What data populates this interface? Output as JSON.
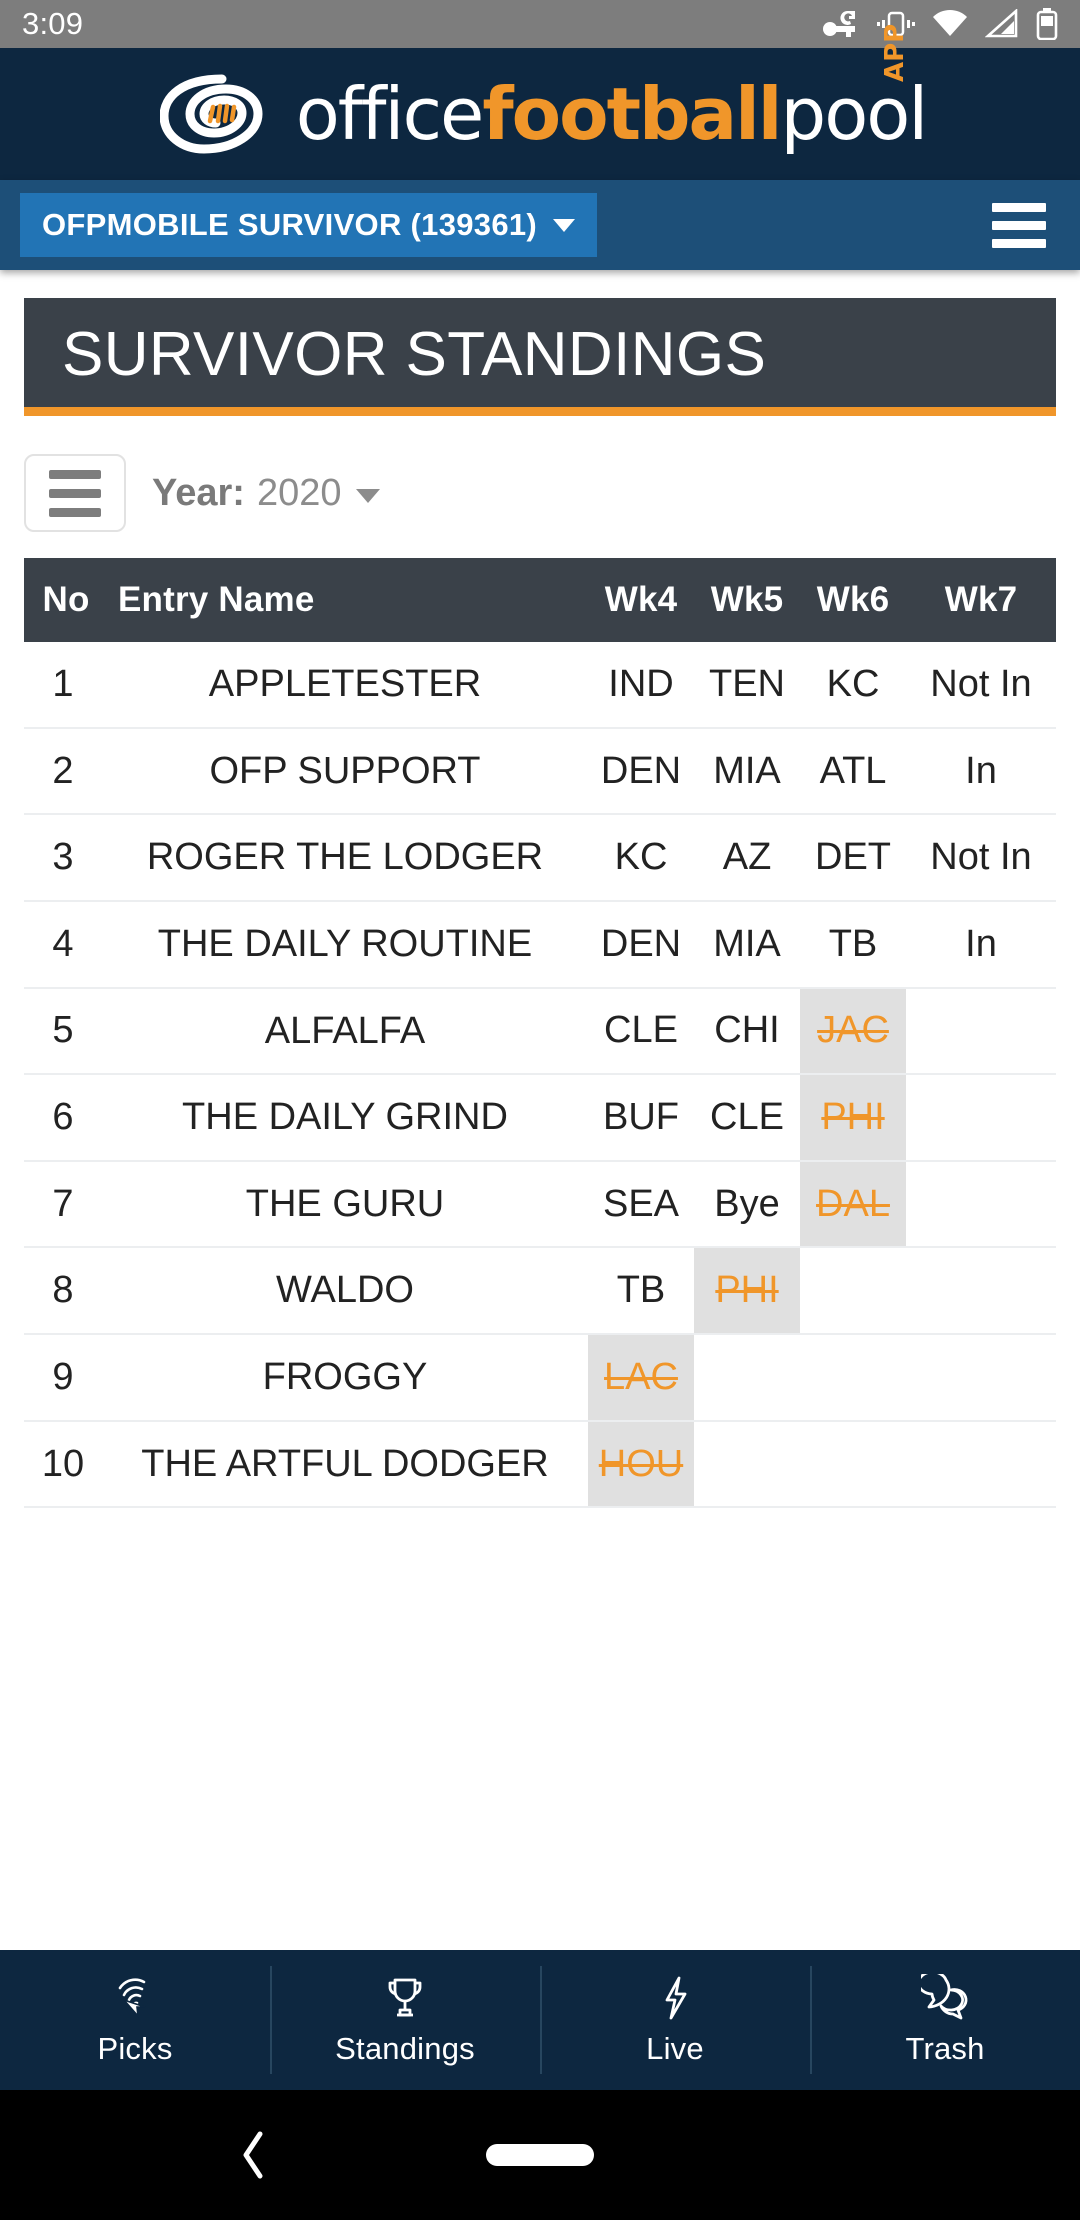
{
  "status_bar": {
    "time": "3:09",
    "icons": [
      "vpn-key-icon",
      "vibrate-icon",
      "wifi-icon",
      "signal-icon",
      "battery-icon"
    ]
  },
  "brand": {
    "part_office": "office",
    "part_football": "football",
    "part_pool": "pool",
    "badge": "APP",
    "logo_icon": "football-spiral-logo",
    "colors": {
      "navy": "#0d2740",
      "orange": "#f0962a",
      "white": "#ffffff"
    }
  },
  "pool_bar": {
    "pool_name": "OFPMOBILE SURVIVOR (139361)",
    "dropdown_icon": "chevron-down-icon",
    "menu_icon": "hamburger-menu-icon",
    "background": "#1d4f78",
    "select_background": "#2274b5"
  },
  "page": {
    "title": "SURVIVOR STANDINGS",
    "title_bg": "#3a4149",
    "title_underline": "#f0962a"
  },
  "filters": {
    "list_toggle_icon": "hamburger-list-icon",
    "year_label": "Year:",
    "year_value": "2020",
    "year_caret_icon": "caret-down-icon"
  },
  "table": {
    "columns": [
      "No",
      "Entry Name",
      "Wk4",
      "Wk5",
      "Wk6",
      "Wk7"
    ],
    "header_bg": "#3a4149",
    "pick_color": "#2383c4",
    "eliminated_color": "#f0962a",
    "in_bg": "#1b75bc",
    "not_in_bg": "#f0962a",
    "dead_cell_bg": "#c2c2c2",
    "out_cell_bg": "#e0e0e0",
    "rows": [
      {
        "no": "1",
        "name": "APPLETESTER",
        "wk4": "IND",
        "wk5": "TEN",
        "wk6": "KC",
        "wk7": "Not In",
        "wk4_state": "pick",
        "wk5_state": "pick",
        "wk6_state": "pick",
        "wk7_state": "not-in"
      },
      {
        "no": "2",
        "name": "OFP SUPPORT",
        "wk4": "DEN",
        "wk5": "MIA",
        "wk6": "ATL",
        "wk7": "In",
        "wk4_state": "pick",
        "wk5_state": "pick",
        "wk6_state": "pick",
        "wk7_state": "in"
      },
      {
        "no": "3",
        "name": "ROGER THE LODGER",
        "wk4": "KC",
        "wk5": "AZ",
        "wk6": "DET",
        "wk7": "Not In",
        "wk4_state": "pick",
        "wk5_state": "pick",
        "wk6_state": "pick",
        "wk7_state": "not-in"
      },
      {
        "no": "4",
        "name": "THE DAILY ROUTINE",
        "wk4": "DEN",
        "wk5": "MIA",
        "wk6": "TB",
        "wk7": "In",
        "wk4_state": "pick",
        "wk5_state": "pick",
        "wk6_state": "pick",
        "wk7_state": "in"
      },
      {
        "no": "5",
        "name": "ALFALFA",
        "wk4": "CLE",
        "wk5": "CHI",
        "wk6": "JAC",
        "wk7": "",
        "wk4_state": "pick",
        "wk5_state": "pick",
        "wk6_state": "out",
        "wk7_state": "dead"
      },
      {
        "no": "6",
        "name": "THE DAILY GRIND",
        "wk4": "BUF",
        "wk5": "CLE",
        "wk6": "PHI",
        "wk7": "",
        "wk4_state": "pick",
        "wk5_state": "pick",
        "wk6_state": "out",
        "wk7_state": "dead"
      },
      {
        "no": "7",
        "name": "THE GURU",
        "wk4": "SEA",
        "wk5": "Bye",
        "wk6": "DAL",
        "wk7": "",
        "wk4_state": "pick",
        "wk5_state": "pick",
        "wk6_state": "out",
        "wk7_state": "dead"
      },
      {
        "no": "8",
        "name": "WALDO",
        "wk4": "TB",
        "wk5": "PHI",
        "wk6": "",
        "wk7": "",
        "wk4_state": "pick",
        "wk5_state": "out",
        "wk6_state": "dead",
        "wk7_state": "dead"
      },
      {
        "no": "9",
        "name": "FROGGY",
        "wk4": "LAC",
        "wk5": "",
        "wk6": "",
        "wk7": "",
        "wk4_state": "out",
        "wk5_state": "dead",
        "wk6_state": "dead",
        "wk7_state": "dead"
      },
      {
        "no": "10",
        "name": "THE ARTFUL DODGER",
        "wk4": "HOU",
        "wk5": "",
        "wk6": "",
        "wk7": "",
        "wk4_state": "out",
        "wk5_state": "dead",
        "wk6_state": "dead",
        "wk7_state": "dead"
      }
    ]
  },
  "bottom_nav": {
    "background": "#0d2740",
    "items": [
      {
        "label": "Picks",
        "icon": "fingerprint-tap-icon"
      },
      {
        "label": "Standings",
        "icon": "trophy-icon"
      },
      {
        "label": "Live",
        "icon": "lightning-bolt-icon"
      },
      {
        "label": "Trash",
        "icon": "chat-bubbles-icon"
      }
    ]
  },
  "android_nav": {
    "back_icon": "back-chevron-icon",
    "home_icon": "home-pill-icon"
  }
}
